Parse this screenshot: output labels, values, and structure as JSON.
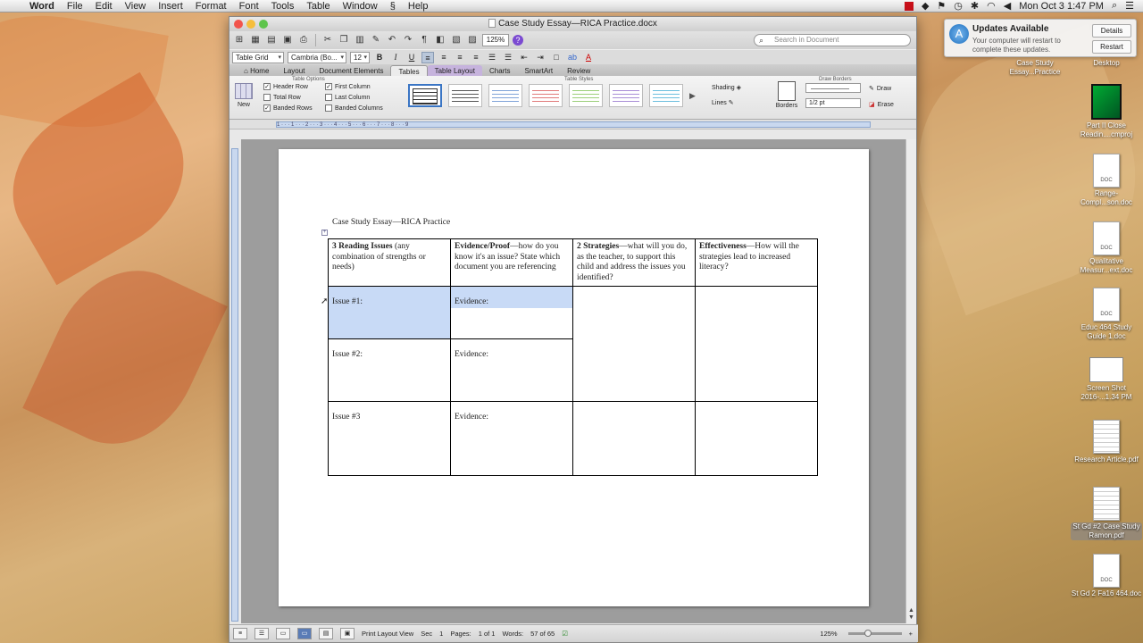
{
  "menubar": {
    "app": "Word",
    "items": [
      "File",
      "Edit",
      "View",
      "Insert",
      "Format",
      "Font",
      "Tools",
      "Table",
      "Window",
      "Help"
    ],
    "clock": "Mon Oct 3  1:47 PM"
  },
  "notification": {
    "title": "Updates Available",
    "body": "Your computer will restart to complete these updates.",
    "details": "Details",
    "restart": "Restart"
  },
  "desktop": {
    "items": [
      {
        "label": "Desktop"
      },
      {
        "label": "Case Study Essay...Practice"
      },
      {
        "label": "Part II Close Readin....cmproj"
      },
      {
        "label": "Range-Compl...son.doc"
      },
      {
        "label": "Qualitative Measur...ext.doc"
      },
      {
        "label": "Educ 464 Study Guide 1.doc"
      },
      {
        "label": "Screen Shot 2016-...1.34 PM"
      },
      {
        "label": "Research Article.pdf"
      },
      {
        "label": "St Gd #2 Case Study Ramon.pdf"
      },
      {
        "label": "St Gd 2 Fa16 464.doc"
      }
    ],
    "doc_badge": "DOC"
  },
  "window": {
    "title": "Case Study Essay—RICA Practice.docx",
    "zoom": "125%",
    "search_placeholder": "Search in Document",
    "style_name": "Table Grid",
    "font_name": "Cambria (Bo...",
    "font_size": "12",
    "tabs": [
      "Home",
      "Layout",
      "Document Elements",
      "Tables",
      "Table Layout",
      "Charts",
      "SmartArt",
      "Review"
    ],
    "ribbon": {
      "group_table_options": "Table Options",
      "group_table_styles": "Table Styles",
      "group_draw_borders": "Draw Borders",
      "new_label": "New",
      "header_row": "Header Row",
      "total_row": "Total Row",
      "banded_rows": "Banded Rows",
      "first_column": "First Column",
      "last_column": "Last Column",
      "banded_columns": "Banded Columns",
      "shading": "Shading",
      "lines": "Lines",
      "borders": "Borders",
      "line_weight": "1/2 pt",
      "draw": "Draw",
      "erase": "Erase"
    },
    "ruler_marks": "1 · · · 1 · · · 2 · · · 3 · · · 4 · · · 5 · · · 6 · · · 7 · · · 8 · · · 9"
  },
  "document": {
    "title": "Case Study Essay—RICA Practice",
    "header": [
      {
        "bold": "3 Reading Issues",
        "rest": " (any combination of strengths or needs)"
      },
      {
        "bold": "Evidence/Proof",
        "rest": "—how do you know it's an issue? State which document you are referencing"
      },
      {
        "bold": "2 Strategies",
        "rest": "—what will you do, as the teacher, to support this child and address the issues you identified?"
      },
      {
        "bold": "Effectiveness",
        "rest": "—How will the strategies lead to increased literacy?"
      }
    ],
    "rows": [
      {
        "issue": "Issue #1:",
        "evidence": "Evidence:"
      },
      {
        "issue": "Issue #2:",
        "evidence": "Evidence:"
      },
      {
        "issue": "Issue #3",
        "evidence": "Evidence:"
      }
    ]
  },
  "statusbar": {
    "view": "Print Layout View",
    "sec_label": "Sec",
    "sec": "1",
    "pages_label": "Pages:",
    "pages": "1 of 1",
    "words_label": "Words:",
    "words": "57 of 65",
    "zoom": "125%"
  }
}
